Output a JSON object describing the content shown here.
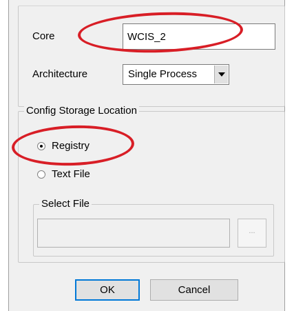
{
  "core": {
    "label": "Core",
    "value": "WCIS_2"
  },
  "architecture": {
    "label": "Architecture",
    "selected": "Single Process"
  },
  "config_storage": {
    "legend": "Config Storage Location",
    "options": [
      {
        "label": "Registry",
        "checked": true
      },
      {
        "label": "Text File",
        "checked": false
      }
    ],
    "select_file": {
      "legend": "Select File",
      "value": "",
      "browse_label": "..."
    }
  },
  "buttons": {
    "ok": "OK",
    "cancel": "Cancel"
  },
  "annotations": {
    "color": "#d81e26"
  }
}
